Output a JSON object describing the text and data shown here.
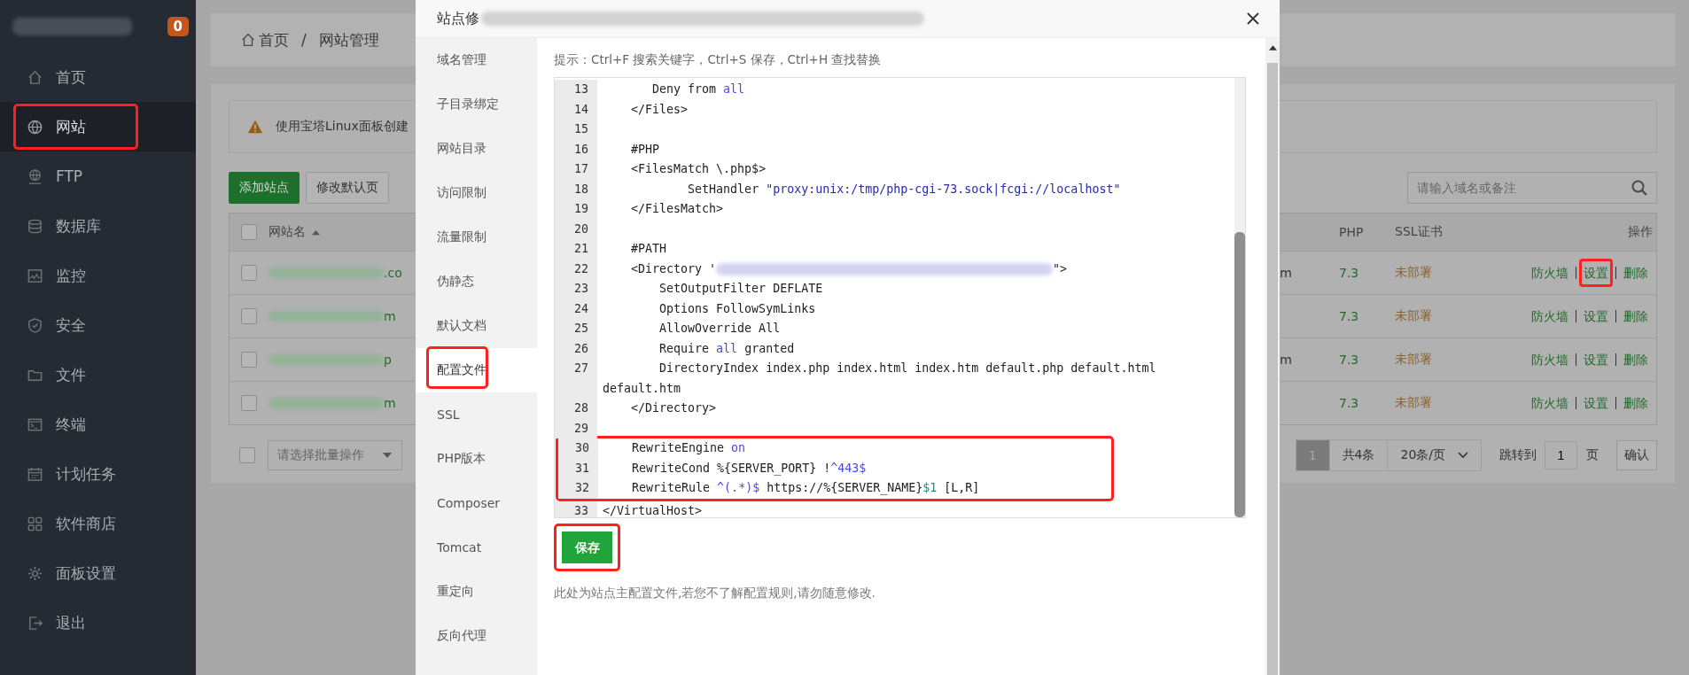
{
  "sidebar": {
    "badge": "0",
    "items": [
      {
        "label": "首页",
        "selected": false,
        "highlighted": false
      },
      {
        "label": "网站",
        "selected": true,
        "highlighted": true
      },
      {
        "label": "FTP",
        "selected": false,
        "highlighted": false
      },
      {
        "label": "数据库",
        "selected": false,
        "highlighted": false
      },
      {
        "label": "监控",
        "selected": false,
        "highlighted": false
      },
      {
        "label": "安全",
        "selected": false,
        "highlighted": false
      },
      {
        "label": "文件",
        "selected": false,
        "highlighted": false
      },
      {
        "label": "终端",
        "selected": false,
        "highlighted": false
      },
      {
        "label": "计划任务",
        "selected": false,
        "highlighted": false
      },
      {
        "label": "软件商店",
        "selected": false,
        "highlighted": false
      },
      {
        "label": "面板设置",
        "selected": false,
        "highlighted": false
      },
      {
        "label": "退出",
        "selected": false,
        "highlighted": false
      }
    ]
  },
  "breadcrumb": {
    "home": "首页",
    "separator": "/",
    "current": "网站管理"
  },
  "notice": "使用宝塔Linux面板创建",
  "toolbar": {
    "buttons": [
      {
        "label": "添加站点",
        "kind": "primary"
      },
      {
        "label": "修改默认页",
        "kind": "default"
      }
    ],
    "search": {
      "placeholder": "请输入域名或备注"
    }
  },
  "table": {
    "header_checked": false,
    "columns": [
      "网站名",
      "PHP",
      "SSL证书",
      "操作"
    ],
    "rows": [
      {
        "checked": false,
        "name_tail": ".co",
        "column_3": "m",
        "php": "7.3",
        "ssl": "未部署",
        "actions": [
          {
            "label": "防火墙",
            "highlighted": false
          },
          {
            "label": "设置",
            "highlighted": true
          },
          {
            "label": "删除",
            "highlighted": false
          }
        ]
      },
      {
        "checked": false,
        "name_tail": "m",
        "php": "7.3",
        "ssl": "未部署",
        "actions": [
          {
            "label": "防火墙",
            "highlighted": false
          },
          {
            "label": "设置",
            "highlighted": false
          },
          {
            "label": "删除",
            "highlighted": false
          }
        ]
      },
      {
        "checked": false,
        "name_tail": "p",
        "column_3": "m",
        "php": "7.3",
        "ssl": "未部署",
        "actions": [
          {
            "label": "防火墙",
            "highlighted": false
          },
          {
            "label": "设置",
            "highlighted": false
          },
          {
            "label": "删除",
            "highlighted": false
          }
        ]
      },
      {
        "checked": false,
        "name_tail": "m",
        "php": "7.3",
        "ssl": "未部署",
        "actions": [
          {
            "label": "防火墙",
            "highlighted": false
          },
          {
            "label": "设置",
            "highlighted": false
          },
          {
            "label": "删除",
            "highlighted": false
          }
        ]
      }
    ]
  },
  "footer": {
    "batch_checked": false,
    "batch_placeholder": "请选择批量操作",
    "pages": [
      {
        "label": "1",
        "selected": true
      }
    ],
    "total": "共4条",
    "page_size": "20条/页",
    "goto_label": "跳转到",
    "goto_value": "1",
    "page_unit": "页",
    "confirm": "确认"
  },
  "modal": {
    "title": "站点修",
    "tabs": [
      {
        "label": "域名管理",
        "selected": false,
        "highlighted": false
      },
      {
        "label": "子目录绑定",
        "selected": false,
        "highlighted": false
      },
      {
        "label": "网站目录",
        "selected": false,
        "highlighted": false
      },
      {
        "label": "访问限制",
        "selected": false,
        "highlighted": false
      },
      {
        "label": "流量限制",
        "selected": false,
        "highlighted": false
      },
      {
        "label": "伪静态",
        "selected": false,
        "highlighted": false
      },
      {
        "label": "默认文档",
        "selected": false,
        "highlighted": false
      },
      {
        "label": "配置文件",
        "selected": true,
        "highlighted": true
      },
      {
        "label": "SSL",
        "selected": false,
        "highlighted": false
      },
      {
        "label": "PHP版本",
        "selected": false,
        "highlighted": false
      },
      {
        "label": "Composer",
        "selected": false,
        "highlighted": false
      },
      {
        "label": "Tomcat",
        "selected": false,
        "highlighted": false
      },
      {
        "label": "重定向",
        "selected": false,
        "highlighted": false
      },
      {
        "label": "反向代理",
        "selected": false,
        "highlighted": false
      }
    ],
    "hint": "提示：Ctrl+F 搜索关键字，Ctrl+S 保存，Ctrl+H 查找替换",
    "code": {
      "blocks": [
        {
          "highlighted": false,
          "lines": [
            {
              "number": "13",
              "segments": [
                {
                  "kind": "text",
                  "text": "       Deny from "
                },
                {
                  "kind": "keyword",
                  "text": "all"
                }
              ]
            },
            {
              "number": "14",
              "segments": [
                {
                  "kind": "text",
                  "text": "    </Files>"
                }
              ]
            },
            {
              "number": "15"
            },
            {
              "number": "16",
              "segments": [
                {
                  "kind": "text",
                  "text": "    #PHP"
                }
              ]
            },
            {
              "number": "17",
              "segments": [
                {
                  "kind": "text",
                  "text": "    <FilesMatch \\.php$>"
                }
              ]
            },
            {
              "number": "18",
              "segments": [
                {
                  "kind": "text",
                  "text": "            SetHandler "
                },
                {
                  "kind": "string",
                  "text": "\"proxy:unix:/tmp/php-cgi-73.sock|fcgi://localhost\""
                }
              ]
            },
            {
              "number": "19",
              "segments": [
                {
                  "kind": "text",
                  "text": "    </FilesMatch>"
                }
              ]
            },
            {
              "number": "20"
            },
            {
              "number": "21",
              "segments": [
                {
                  "kind": "text",
                  "text": "    #PATH"
                }
              ]
            },
            {
              "number": "22",
              "segments": [
                {
                  "kind": "text",
                  "text": "    <Directory '"
                },
                {
                  "kind": "redacted"
                },
                {
                  "kind": "text",
                  "text": "\">"
                }
              ]
            },
            {
              "number": "23",
              "segments": [
                {
                  "kind": "text",
                  "text": "        SetOutputFilter DEFLATE"
                }
              ]
            },
            {
              "number": "24",
              "segments": [
                {
                  "kind": "text",
                  "text": "        Options FollowSymLinks"
                }
              ]
            },
            {
              "number": "25",
              "segments": [
                {
                  "kind": "text",
                  "text": "        AllowOverride All"
                }
              ]
            },
            {
              "number": "26",
              "segments": [
                {
                  "kind": "text",
                  "text": "        Require "
                },
                {
                  "kind": "keyword",
                  "text": "all"
                },
                {
                  "kind": "text",
                  "text": " granted"
                }
              ]
            },
            {
              "number": "27",
              "segments": [
                {
                  "kind": "text",
                  "text": "        DirectoryIndex index.php index.html index.htm default.php default.html default.htm"
                }
              ]
            },
            {
              "number": "28",
              "segments": [
                {
                  "kind": "text",
                  "text": "    </Directory>"
                }
              ]
            },
            {
              "number": "29"
            }
          ]
        },
        {
          "highlighted": true,
          "lines": [
            {
              "number": "30",
              "segments": [
                {
                  "kind": "text",
                  "text": "    RewriteEngine "
                },
                {
                  "kind": "keyword",
                  "text": "on"
                }
              ]
            },
            {
              "number": "31",
              "segments": [
                {
                  "kind": "text",
                  "text": "    RewriteCond %{SERVER_PORT} !"
                },
                {
                  "kind": "keyword",
                  "text": "^443$"
                }
              ]
            },
            {
              "number": "32",
              "segments": [
                {
                  "kind": "text",
                  "text": "    RewriteRule "
                },
                {
                  "kind": "keyword",
                  "text": "^(.*)$"
                },
                {
                  "kind": "text",
                  "text": " https://%{SERVER_NAME}"
                },
                {
                  "kind": "variable",
                  "text": "$1"
                },
                {
                  "kind": "text",
                  "text": " [L,R]"
                }
              ]
            }
          ]
        },
        {
          "highlighted": false,
          "lines": [
            {
              "number": "33",
              "segments": [
                {
                  "kind": "text",
                  "text": "</VirtualHost>"
                }
              ]
            }
          ]
        }
      ]
    },
    "save": {
      "label": "保存",
      "highlighted": true
    },
    "note": "此处为站点主配置文件,若您不了解配置规则,请勿随意修改."
  }
}
